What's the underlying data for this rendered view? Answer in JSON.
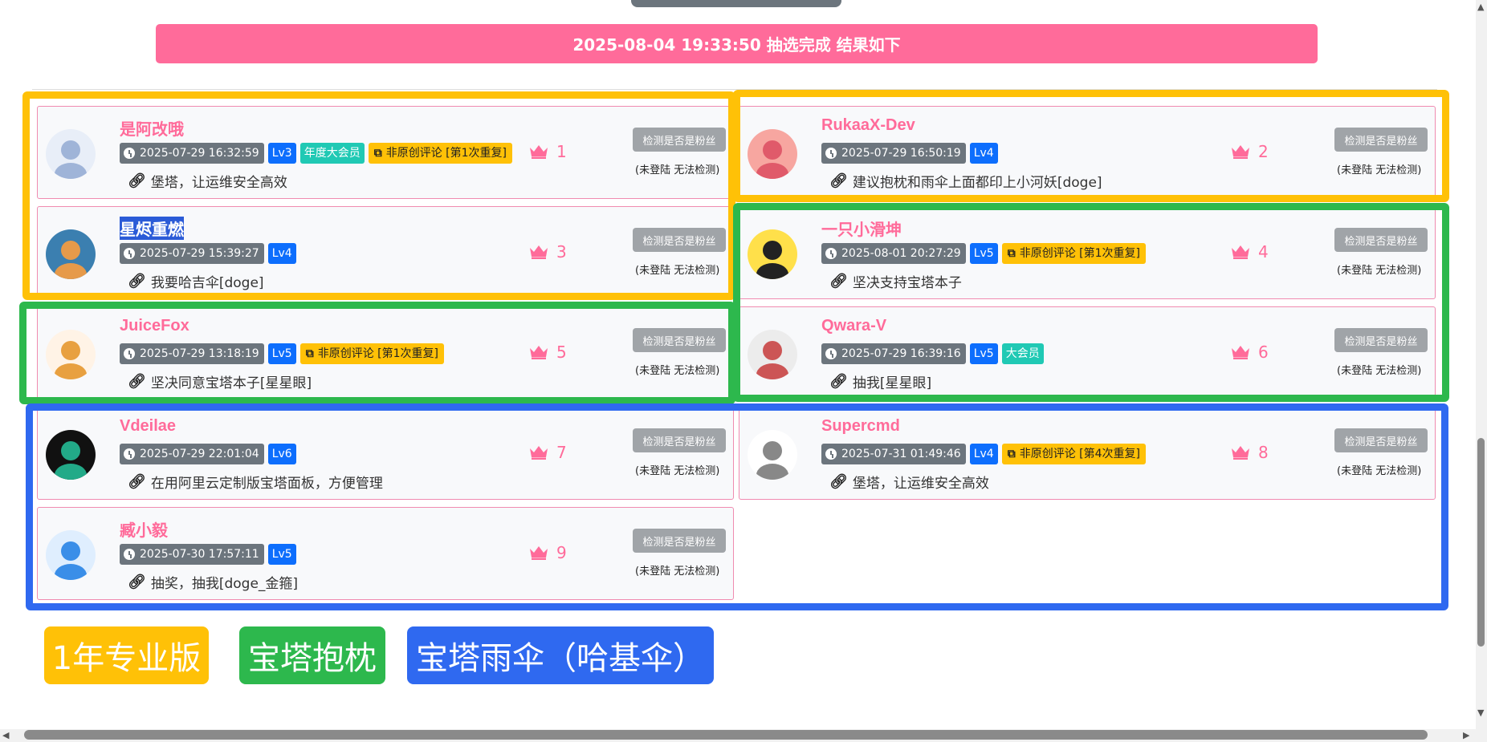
{
  "banner": "2025-08-04 19:33:50 抽选完成 结果如下",
  "check_label": "检测是否是粉丝",
  "note_label": "(未登陆 无法检测)",
  "colors": {
    "gold": "#ffc107",
    "green": "#2db84d",
    "blue": "#2f69f0",
    "pink": "#ff6b9a"
  },
  "entries": [
    {
      "name": "是阿改哦",
      "time": "2025-07-29 16:32:59",
      "level": "Lv3",
      "vip": "年度大会员",
      "warn": "非原创评论 [第1次重复]",
      "comment": "堡塔，让运维安全高效",
      "rank": "1"
    },
    {
      "name": "RukaaX-Dev",
      "time": "2025-07-29 16:50:19",
      "level": "Lv4",
      "vip": "",
      "warn": "",
      "comment": "建议抱枕和雨伞上面都印上小河妖[doge]",
      "rank": "2"
    },
    {
      "name": "星烬重燃",
      "time": "2025-07-29 15:39:27",
      "level": "Lv4",
      "vip": "",
      "warn": "",
      "comment": "我要哈吉伞[doge]",
      "rank": "3"
    },
    {
      "name": "一只小滑坤",
      "time": "2025-08-01 20:27:29",
      "level": "Lv5",
      "vip": "",
      "warn": "非原创评论 [第1次重复]",
      "comment": "坚决支持宝塔本子",
      "rank": "4"
    },
    {
      "name": "JuiceFox",
      "time": "2025-07-29 13:18:19",
      "level": "Lv5",
      "vip": "",
      "warn": "非原创评论 [第1次重复]",
      "comment": "坚决同意宝塔本子[星星眼]",
      "rank": "5"
    },
    {
      "name": "Qwara-V",
      "time": "2025-07-29 16:39:16",
      "level": "Lv5",
      "vip": "大会员",
      "warn": "",
      "comment": "抽我[星星眼]",
      "rank": "6"
    },
    {
      "name": "Vdeilae",
      "time": "2025-07-29 22:01:04",
      "level": "Lv6",
      "vip": "",
      "warn": "",
      "comment": "在用阿里云定制版宝塔面板，方便管理",
      "rank": "7"
    },
    {
      "name": "Supercmd",
      "time": "2025-07-31 01:49:46",
      "level": "Lv4",
      "vip": "",
      "warn": "非原创评论 [第4次重复]",
      "comment": "堡塔，让运维安全高效",
      "rank": "8"
    },
    {
      "name": "臧小毅",
      "time": "2025-07-30 17:57:11",
      "level": "Lv5",
      "vip": "",
      "warn": "",
      "comment": "抽奖，抽我[doge_金箍]",
      "rank": "9"
    }
  ],
  "prizes": [
    "1年专业版",
    "宝塔抱枕",
    "宝塔雨伞（哈基伞）"
  ]
}
